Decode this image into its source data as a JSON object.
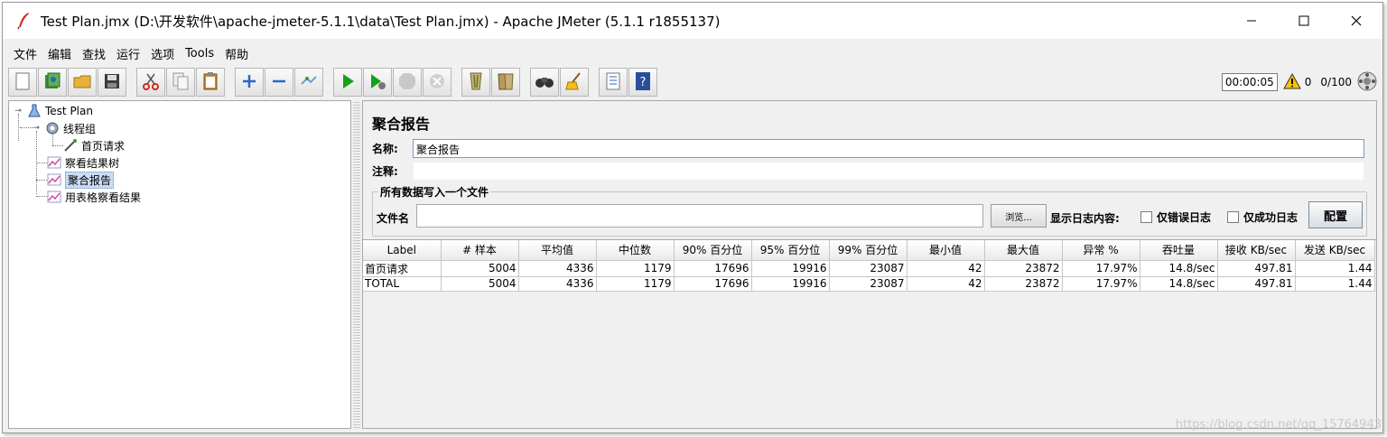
{
  "window": {
    "title": "Test Plan.jmx (D:\\开发软件\\apache-jmeter-5.1.1\\data\\Test Plan.jmx) - Apache JMeter (5.1.1 r1855137)"
  },
  "menu": [
    "文件",
    "编辑",
    "查找",
    "运行",
    "选项",
    "Tools",
    "帮助"
  ],
  "toolbar": {
    "icons": [
      "new-icon",
      "templates-icon",
      "open-icon",
      "save-icon",
      "cut-icon",
      "copy-icon",
      "paste-icon",
      "expand-icon",
      "collapse-icon",
      "toggle-icon",
      "start-icon",
      "start-no-pause-icon",
      "stop-icon",
      "shutdown-icon",
      "clear-icon",
      "clear-all-icon",
      "search-icon",
      "reset-search-icon",
      "function-helper-icon",
      "help-icon"
    ],
    "timer": "00:00:05",
    "warning_count": "0",
    "threads": "0/100"
  },
  "tree": {
    "root": "Test Plan",
    "thread_group": "线程组",
    "sampler": "首页请求",
    "listeners": [
      "察看结果树",
      "聚合报告",
      "用表格察看结果"
    ]
  },
  "panel": {
    "title": "聚合报告",
    "name_label": "名称:",
    "name_value": "聚合报告",
    "comment_label": "注释:",
    "comment_value": "",
    "fieldset_legend": "所有数据写入一个文件",
    "file_label": "文件名",
    "file_value": "",
    "browse_label": "浏览...",
    "log_label": "显示日志内容:",
    "errors_only_label": "仅错误日志",
    "success_only_label": "仅成功日志",
    "config_label": "配置"
  },
  "table": {
    "columns": [
      "Label",
      "# 样本",
      "平均值",
      "中位数",
      "90% 百分位",
      "95% 百分位",
      "99% 百分位",
      "最小值",
      "最大值",
      "异常 %",
      "吞吐量",
      "接收 KB/sec",
      "发送 KB/sec"
    ],
    "rows": [
      [
        "首页请求",
        "5004",
        "4336",
        "1179",
        "17696",
        "19916",
        "23087",
        "42",
        "23872",
        "17.97%",
        "14.8/sec",
        "497.81",
        "1.44"
      ],
      [
        "TOTAL",
        "5004",
        "4336",
        "1179",
        "17696",
        "19916",
        "23087",
        "42",
        "23872",
        "17.97%",
        "14.8/sec",
        "497.81",
        "1.44"
      ]
    ]
  },
  "watermark": "https://blog.csdn.net/qq_15764943",
  "colors": {
    "selection": "#c9dcf5",
    "accent_blue": "#2a66c9",
    "run_green": "#18a018",
    "warning_yellow": "#f5c400"
  }
}
